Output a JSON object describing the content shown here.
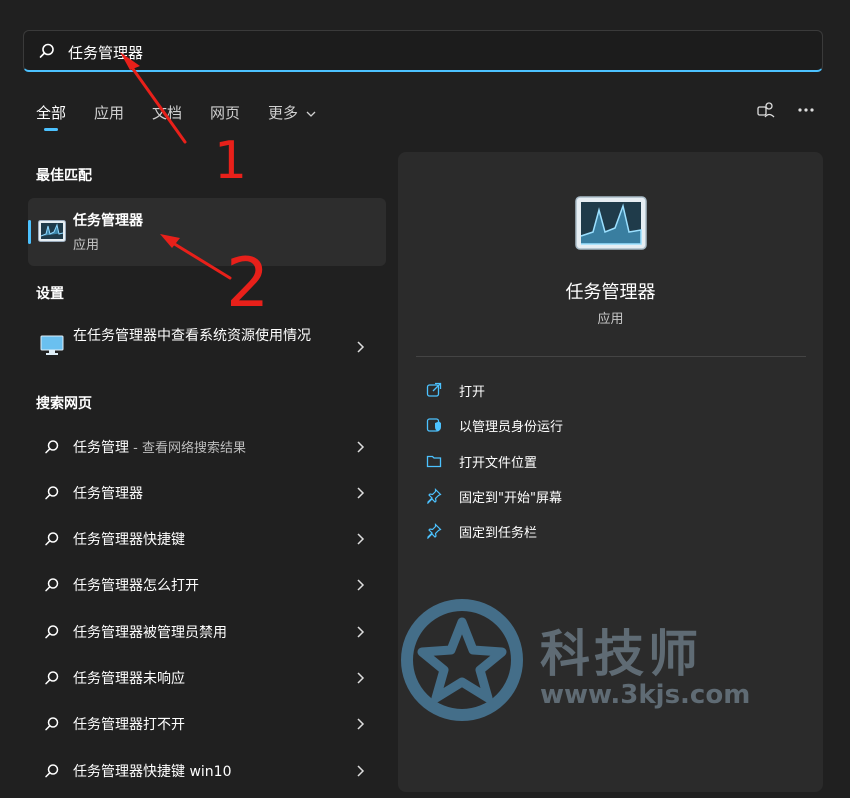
{
  "search": {
    "value": "任务管理器"
  },
  "tabs": [
    {
      "label": "全部",
      "active": true
    },
    {
      "label": "应用"
    },
    {
      "label": "文档"
    },
    {
      "label": "网页"
    },
    {
      "label": "更多"
    }
  ],
  "sections": {
    "best_match": "最佳匹配",
    "settings": "设置",
    "web": "搜索网页"
  },
  "best_match": {
    "name": "任务管理器",
    "type": "应用"
  },
  "settings_item": {
    "label": "在任务管理器中查看系统资源使用情况"
  },
  "web_results": [
    {
      "label": "任务管理",
      "suffix": " - 查看网络搜索结果"
    },
    {
      "label": "任务管理器"
    },
    {
      "label": "任务管理器快捷键"
    },
    {
      "label": "任务管理器怎么打开"
    },
    {
      "label": "任务管理器被管理员禁用"
    },
    {
      "label": "任务管理器未响应"
    },
    {
      "label": "任务管理器打不开"
    },
    {
      "label": "任务管理器快捷键 win10"
    }
  ],
  "detail": {
    "title": "任务管理器",
    "subtitle": "应用",
    "actions": [
      {
        "label": "打开",
        "icon": "open-external-icon"
      },
      {
        "label": "以管理员身份运行",
        "icon": "admin-shield-icon"
      },
      {
        "label": "打开文件位置",
        "icon": "folder-icon"
      },
      {
        "label": "固定到\"开始\"屏幕",
        "icon": "pin-icon"
      },
      {
        "label": "固定到任务栏",
        "icon": "pin-icon"
      }
    ]
  },
  "annotations": {
    "step1": "1",
    "step2": "2"
  },
  "watermark": {
    "name": "科技师",
    "url": "www.3kjs.com"
  },
  "colors": {
    "accent": "#4cc2ff",
    "arrow": "#e8201a",
    "bg": "#202020",
    "panel": "#2b2b2b"
  }
}
